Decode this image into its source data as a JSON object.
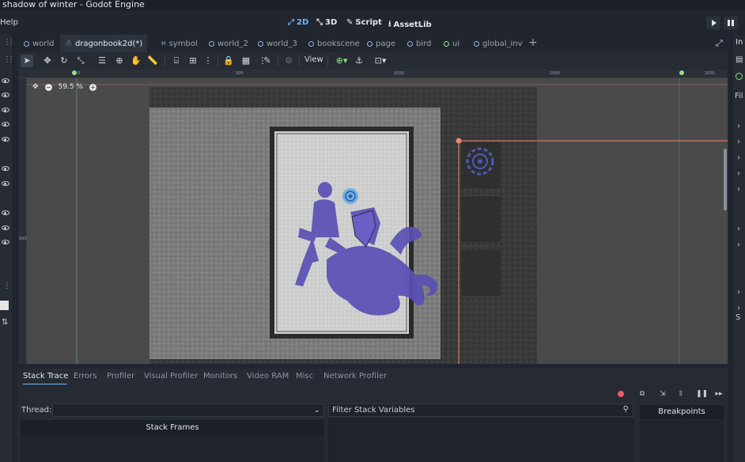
{
  "window": {
    "title": "shadow of winter - Godot Engine"
  },
  "menu": {
    "help": "Help"
  },
  "workspaces": [
    {
      "label": "2D",
      "icon": "2d-icon",
      "active": true
    },
    {
      "label": "3D",
      "icon": "3d-icon",
      "active": false
    },
    {
      "label": "Script",
      "icon": "script-icon",
      "active": false
    },
    {
      "label": "AssetLib",
      "icon": "assetlib-icon",
      "active": false
    }
  ],
  "scene_tabs": [
    {
      "label": "world",
      "active": false
    },
    {
      "label": "dragonbook2d(*)",
      "active": true
    },
    {
      "label": "symbol",
      "active": false
    },
    {
      "label": "world_2",
      "active": false
    },
    {
      "label": "world_3",
      "active": false
    },
    {
      "label": "bookscene",
      "active": false
    },
    {
      "label": "page",
      "active": false
    },
    {
      "label": "bird",
      "active": false
    },
    {
      "label": "ui",
      "active": false
    },
    {
      "label": "global_inv",
      "active": false
    }
  ],
  "toolbar": {
    "view_label": "View"
  },
  "viewport": {
    "zoom": "59.5 %",
    "ruler_top": [
      "0",
      "500",
      "1000",
      "1500",
      "2000"
    ],
    "ruler_left": [
      "500"
    ]
  },
  "debugger": {
    "tabs": [
      "Stack Trace",
      "Errors",
      "Profiler",
      "Visual Profiler",
      "Monitors",
      "Video RAM",
      "Misc",
      "Network Profiler"
    ],
    "thread_label": "Thread:",
    "stack_frames": "Stack Frames",
    "filter_placeholder": "Filter Stack Variables",
    "breakpoints": "Breakpoints"
  },
  "right_dock": {
    "header_fragment": "In",
    "filter_fragment": "Fil",
    "s_fragment": "S"
  },
  "colors": {
    "accent": "#6fb7ff",
    "selection": "#e8886a",
    "tint": "#5a4fb4",
    "breakpoint_dot": "#e85b67"
  }
}
